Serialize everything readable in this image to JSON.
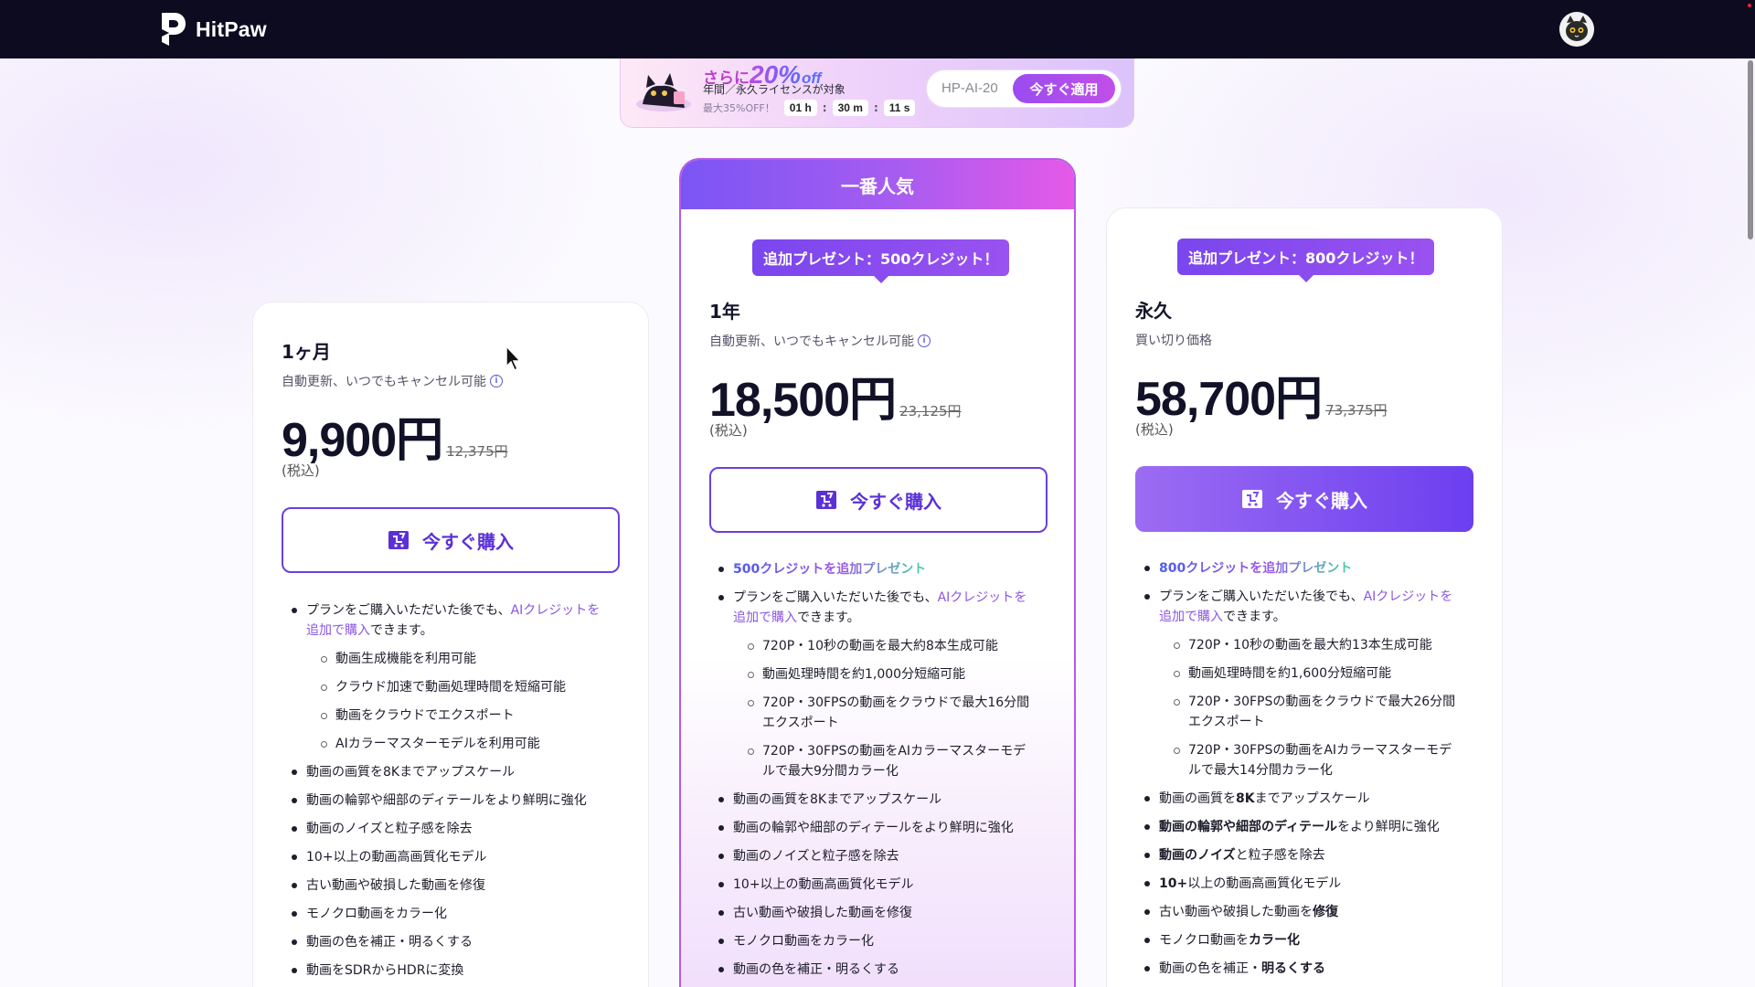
{
  "nav": {
    "logo_text": "HitPaw"
  },
  "promo": {
    "prefix": "さらに",
    "percent": "20%",
    "off": "off",
    "subtitle": "年間／永久ライセンスが対象",
    "timer_label": "最大35%OFF！",
    "hours": "01 h",
    "minutes": "30 m",
    "seconds": "11 s",
    "code": "HP-AI-20",
    "apply_label": "今すぐ適用"
  },
  "plans": [
    {
      "name": "1ヶ月",
      "subtitle": "自動更新、いつでもキャンセル可能",
      "price": "9,900円",
      "old_price": "12,375円",
      "tax": "(税込)",
      "buy_label": "今すぐ購入",
      "features": [
        {
          "type": "main",
          "parts": [
            "プランをご購入いただいた後でも、",
            "AIクレジットを追加で購入",
            "できます。"
          ]
        },
        {
          "type": "sub",
          "text": "動画生成機能を利用可能"
        },
        {
          "type": "sub",
          "text": "クラウド加速で動画処理時間を短縮可能"
        },
        {
          "type": "sub",
          "text": "動画をクラウドでエクスポート"
        },
        {
          "type": "sub",
          "text": "AIカラーマスターモデルを利用可能"
        },
        {
          "type": "item",
          "text": "動画の画質を8Kまでアップスケール"
        },
        {
          "type": "item",
          "text": "動画の輪郭や細部のディテールをより鮮明に強化"
        },
        {
          "type": "item",
          "text": "動画のノイズと粒子感を除去"
        },
        {
          "type": "item",
          "text": "10+以上の動画高画質化モデル"
        },
        {
          "type": "item",
          "text": "古い動画や破損した動画を修復"
        },
        {
          "type": "item",
          "text": "モノクロ動画をカラー化"
        },
        {
          "type": "item",
          "text": "動画の色を補正・明るくする"
        },
        {
          "type": "item",
          "text": "動画をSDRからHDRに変換"
        }
      ]
    },
    {
      "header": "一番人気",
      "gift": "追加プレゼント：500クレジット！",
      "name": "1年",
      "subtitle": "自動更新、いつでもキャンセル可能",
      "price": "18,500円",
      "old_price": "23,125円",
      "tax": "(税込)",
      "buy_label": "今すぐ購入",
      "features": [
        {
          "type": "bonus",
          "text": "500クレジットを追加プレゼント"
        },
        {
          "type": "main",
          "parts": [
            "プランをご購入いただいた後でも、",
            "AIクレジットを追加で購入",
            "できます。"
          ]
        },
        {
          "type": "sub",
          "text": "720P・10秒の動画を最大約8本生成可能"
        },
        {
          "type": "sub",
          "text": "動画処理時間を約1,000分短縮可能"
        },
        {
          "type": "sub",
          "text": "720P・30FPSの動画をクラウドで最大16分間エクスポート"
        },
        {
          "type": "sub",
          "text": "720P・30FPSの動画をAIカラーマスターモデルで最大9分間カラー化"
        },
        {
          "type": "item",
          "text": "動画の画質を8Kまでアップスケール"
        },
        {
          "type": "item",
          "text": "動画の輪郭や細部のディテールをより鮮明に強化"
        },
        {
          "type": "item",
          "text": "動画のノイズと粒子感を除去"
        },
        {
          "type": "item",
          "text": "10+以上の動画高画質化モデル"
        },
        {
          "type": "item",
          "text": "古い動画や破損した動画を修復"
        },
        {
          "type": "item",
          "text": "モノクロ動画をカラー化"
        },
        {
          "type": "item",
          "text": "動画の色を補正・明るくする"
        }
      ]
    },
    {
      "gift": "追加プレゼント：800クレジット！",
      "name": "永久",
      "subtitle": "買い切り価格",
      "price": "58,700円",
      "old_price": "73,375円",
      "tax": "(税込)",
      "buy_label": "今すぐ購入",
      "features": [
        {
          "type": "bonus",
          "text": "800クレジットを追加プレゼント"
        },
        {
          "type": "main",
          "parts": [
            "プランをご購入いただいた後でも、",
            "AIクレジットを追加で購入",
            "できます。"
          ]
        },
        {
          "type": "sub",
          "text": "720P・10秒の動画を最大約13本生成可能"
        },
        {
          "type": "sub",
          "text": "動画処理時間を約1,600分短縮可能"
        },
        {
          "type": "sub",
          "text": "720P・30FPSの動画をクラウドで最大26分間エクスポート"
        },
        {
          "type": "sub",
          "text": "720P・30FPSの動画をAIカラーマスターモデルで最大14分間カラー化"
        },
        {
          "type": "rich",
          "parts": [
            [
              "動画の画質を",
              false
            ],
            [
              "8K",
              true
            ],
            [
              "までアップスケール",
              false
            ]
          ]
        },
        {
          "type": "rich",
          "parts": [
            [
              "動画の輪郭や細部のディテール",
              true
            ],
            [
              "をより鮮明に強化",
              false
            ]
          ]
        },
        {
          "type": "rich",
          "parts": [
            [
              "動画のノイズ",
              true
            ],
            [
              "と粒子感を除去",
              false
            ]
          ]
        },
        {
          "type": "rich",
          "parts": [
            [
              "10+",
              true
            ],
            [
              "以上の動画高画質化モデル",
              false
            ]
          ]
        },
        {
          "type": "rich",
          "parts": [
            [
              "古い動画や破損した動画を",
              false
            ],
            [
              "修復",
              true
            ]
          ]
        },
        {
          "type": "rich",
          "parts": [
            [
              "モノクロ動画を",
              false
            ],
            [
              "カラー化",
              true
            ]
          ]
        },
        {
          "type": "rich",
          "parts": [
            [
              "動画の色を補正・",
              false
            ],
            [
              "明るくする",
              true
            ]
          ]
        }
      ]
    }
  ],
  "colors": {
    "nav_bg": "#0d0b1f",
    "accent": "#6b3fe0",
    "highlight": "#8a55e6",
    "popular_gradient": [
      "#7b55f4",
      "#e559e8"
    ]
  },
  "icons": [
    "hitpaw-logo-icon",
    "avatar-cat-icon",
    "promo-cat-icon",
    "info-icon",
    "cart-icon",
    "mouse-cursor-icon"
  ]
}
